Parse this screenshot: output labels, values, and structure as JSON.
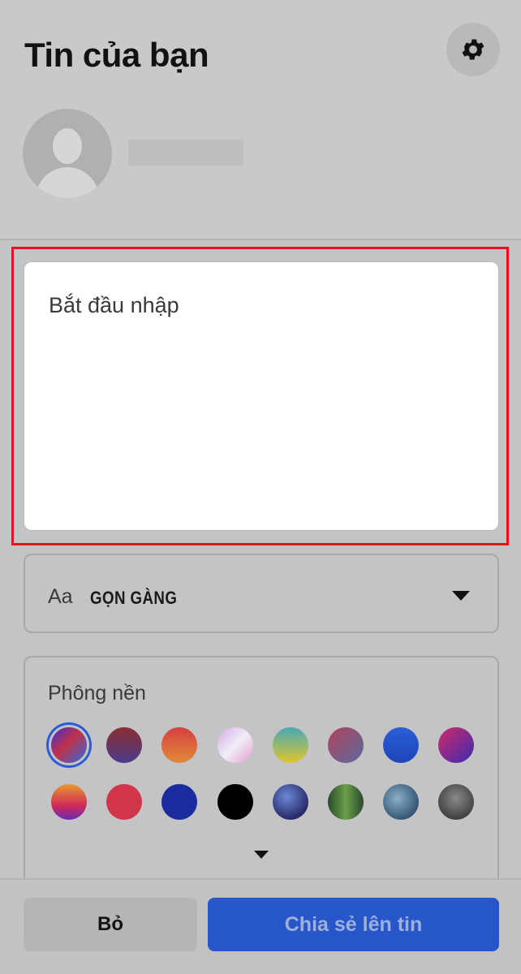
{
  "header": {
    "title": "Tin của bạn",
    "settings_icon": "gear-icon",
    "avatar_icon": "default-avatar-icon"
  },
  "composer": {
    "placeholder": "Bắt đầu nhập"
  },
  "font_select": {
    "icon_text": "Aa",
    "selected_font": "GỌN GÀNG",
    "dropdown_icon": "caret-down-icon"
  },
  "background": {
    "label": "Phông nền",
    "expand_icon": "caret-down-icon",
    "swatches": [
      {
        "css": "linear-gradient(135deg,#3b2fd8 0%,#c0304a 45%,#2b6fe0 100%)",
        "selected": true
      },
      {
        "css": "linear-gradient(180deg,#8b2e2e 0%,#4b3a8c 100%)"
      },
      {
        "css": "linear-gradient(180deg,#d63f3f 0%,#e08a3a 100%)"
      },
      {
        "css": "linear-gradient(135deg,#d6a5e8 0%,#f0f0f6 50%,#e59ad1 100%)"
      },
      {
        "css": "linear-gradient(180deg,#4aa8b8 0%,#e0c62a 100%)"
      },
      {
        "css": "linear-gradient(135deg,#b0445a 0%,#5a6a9e 100%)"
      },
      {
        "css": "linear-gradient(180deg,#2b5fd6 0%,#1e44b8 100%)"
      },
      {
        "css": "linear-gradient(135deg,#d02a6a 0%,#3b2ab0 100%)"
      },
      {
        "css": "linear-gradient(180deg,#e89a2a 0%,#d02a5a 60%,#6a2ab0 100%)"
      },
      {
        "css": "#d0354a"
      },
      {
        "css": "#1a2b9e"
      },
      {
        "css": "#000000"
      },
      {
        "css": "radial-gradient(circle at 40% 35%,#6a8ad6 0%,#2a2a6a 70%)"
      },
      {
        "css": "linear-gradient(90deg,#2a4a2a 0%,#6aa04a 50%,#2a4a2a 100%)"
      },
      {
        "css": "radial-gradient(circle at 40% 40%,#8ab0c8 0%,#2a4a6a 80%)"
      },
      {
        "css": "radial-gradient(circle at 50% 40%,#8a8a8a 0%,#3a3a3a 80%)"
      }
    ]
  },
  "footer": {
    "discard_label": "Bỏ",
    "share_label": "Chia sẻ lên tin"
  }
}
